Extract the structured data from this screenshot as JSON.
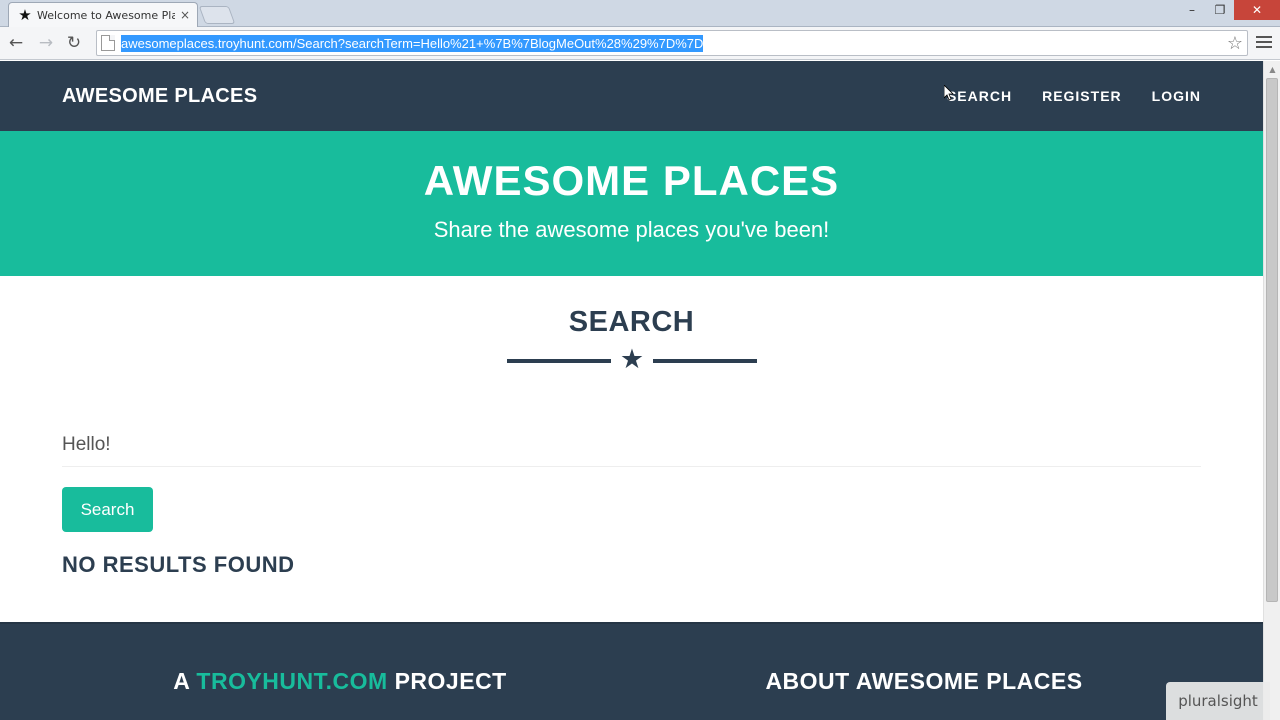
{
  "browser": {
    "tab_title": "Welcome to Awesome Pla",
    "tab_favicon": "★",
    "tab_close": "×",
    "url": "awesomeplaces.troyhunt.com/Search?searchTerm=Hello%21+%7B%7BlogMeOut%28%29%7D%7D",
    "back": "←",
    "forward": "→",
    "reload": "↻",
    "bookmark_star": "☆",
    "minimize": "–",
    "restore": "❐",
    "close": "✕"
  },
  "nav": {
    "brand": "AWESOME PLACES",
    "links": [
      "SEARCH",
      "REGISTER",
      "LOGIN"
    ]
  },
  "header": {
    "title": "AWESOME PLACES",
    "subtitle": "Share the awesome places you've been!"
  },
  "search": {
    "section_title": "SEARCH",
    "divider_star": "★",
    "input_value": "Hello!",
    "button_label": "Search",
    "result_text": "NO RESULTS FOUND"
  },
  "footer": {
    "left_prefix": "A",
    "left_link": "TROYHUNT.COM",
    "left_suffix": "PROJECT",
    "right_title": "ABOUT AWESOME PLACES"
  },
  "watermark": "pluralsight",
  "colors": {
    "navy": "#2c3e50",
    "teal": "#18bc9c",
    "url_highlight": "#3399ff"
  }
}
